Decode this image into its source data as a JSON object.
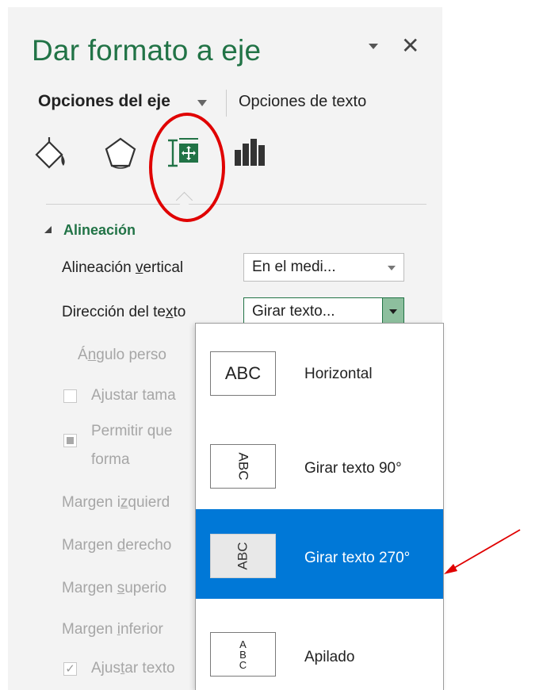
{
  "pane": {
    "title": "Dar formato a eje",
    "close_symbol": "✕",
    "tabs": [
      {
        "label": "Opciones del eje",
        "active": true
      },
      {
        "label": "Opciones de texto",
        "active": false
      }
    ],
    "icons": [
      "fill-line-icon",
      "effects-pentagon-icon",
      "size-properties-icon",
      "axis-options-bar-icon"
    ]
  },
  "section": {
    "title": "Alineación",
    "vertical_alignment": {
      "label_a": "Alineación ",
      "label_u": "v",
      "label_b": "ertical",
      "value": "En el medi..."
    },
    "text_direction": {
      "label_a": "Dirección del te",
      "label_u": "x",
      "label_b": "to",
      "value": "Girar texto..."
    },
    "custom_angle": {
      "label_a": "Á",
      "label_u": "n",
      "label_b": "gulo perso"
    },
    "autofit": {
      "label": "Ajustar tama"
    },
    "overflow": {
      "line1": "Permitir que",
      "line2": "forma"
    },
    "margin_left": {
      "label_a": "Margen i",
      "label_u": "z",
      "label_b": "quierd"
    },
    "margin_right": {
      "label_a": "Margen ",
      "label_u": "d",
      "label_b": "erecho"
    },
    "margin_top": {
      "label_a": "Margen ",
      "label_u": "s",
      "label_b": "uperio"
    },
    "margin_bottom": {
      "label_a": "Margen ",
      "label_u": "i",
      "label_b": "nferior"
    },
    "wrap_text": {
      "label_a": "Ajus",
      "label_u": "t",
      "label_b": "ar texto"
    }
  },
  "menu": {
    "items": [
      {
        "preview": "ABC",
        "label": "Horizontal"
      },
      {
        "preview": "ABC",
        "label": "Girar texto 90°"
      },
      {
        "preview": "ABC",
        "label": "Girar texto 270°"
      },
      {
        "preview": "A\nB\nC",
        "label": "Apilado"
      }
    ],
    "selected_label": "Girar texto 270°"
  },
  "colors": {
    "accent_green": "#217346",
    "selection_blue": "#0078d7",
    "annotation_red": "#e00000"
  }
}
